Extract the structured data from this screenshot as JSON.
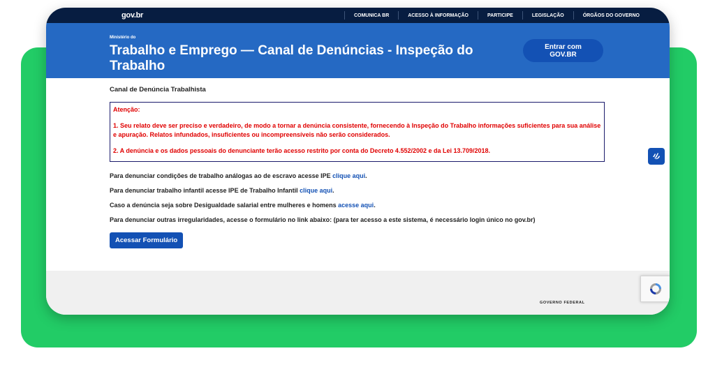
{
  "topbar": {
    "logo": "gov.br",
    "nav": [
      "COMUNICA BR",
      "ACESSO À INFORMAÇÃO",
      "PARTICIPE",
      "LEGISLAÇÃO",
      "ÓRGÃOS DO GOVERNO"
    ]
  },
  "header": {
    "ministry": "Ministério do",
    "title": "Trabalho e Emprego — Canal de Denúncias - Inspeção do Trabalho",
    "login_button": "Entrar com GOV.BR"
  },
  "main": {
    "section_title": "Canal de Denúncia Trabalhista",
    "alert": {
      "heading": "Atenção:",
      "item1": "1. Seu relato deve ser preciso e verdadeiro, de modo a tornar a denúncia consistente, fornecendo à Inspeção do Trabalho informações suficientes para sua análise e apuração. Relatos infundados, insuficientes ou incompreensíveis não serão considerados.",
      "item2": "2. A denúncia e os dados pessoais do denunciante terão acesso restrito por conta do Decreto 4.552/2002 e da Lei 13.709/2018."
    },
    "lines": [
      {
        "text": "Para denunciar condições de trabalho análogas ao de escravo acesse IPE ",
        "link": "clique aqui",
        "suffix": "."
      },
      {
        "text": "Para denunciar trabalho infantil acesse IPE de Trabalho Infantil ",
        "link": "clique aqui",
        "suffix": "."
      },
      {
        "text": "Caso a denúncia seja sobre Desigualdade salarial entre mulheres e homens ",
        "link": "acesse aqui",
        "suffix": "."
      },
      {
        "text": "Para denunciar outras irregularidades, acesse o formulário no link abaixo: (para ter acesso a este sistema, é necessário login único no gov.br)"
      }
    ],
    "form_button": "Acessar Formulário"
  },
  "footer": {
    "label": "GOVERNO FEDERAL"
  },
  "colors": {
    "navy": "#071d41",
    "blue_header": "#2569c3",
    "primary_blue": "#1351b4",
    "alert_red": "#e00000",
    "green_backdrop": "#22cc66"
  },
  "icons": {
    "accessibility": "sign-language-hands-icon",
    "captcha": "recaptcha-icon"
  }
}
